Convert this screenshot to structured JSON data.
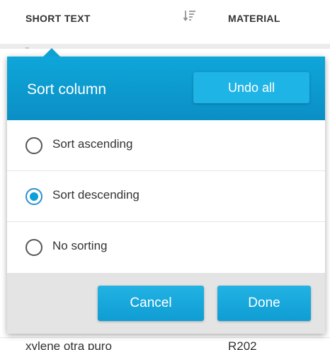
{
  "table": {
    "columns": {
      "short_text": "SHORT TEXT",
      "material": "MATERIAL"
    },
    "peek_row": {
      "short_text": "xylene otra puro",
      "material": "R202"
    },
    "top_peek_char": "¨"
  },
  "popover": {
    "title": "Sort column",
    "undo_label": "Undo all",
    "options": [
      {
        "label": "Sort ascending",
        "selected": false
      },
      {
        "label": "Sort descending",
        "selected": true
      },
      {
        "label": "No sorting",
        "selected": false
      }
    ],
    "cancel_label": "Cancel",
    "done_label": "Done"
  },
  "colors": {
    "accent": "#0ea6d9",
    "button": "#1fb4e6",
    "footer_bg": "#e4e4e4",
    "text": "#333333"
  },
  "icons": {
    "sort": "sort-descending-icon"
  }
}
